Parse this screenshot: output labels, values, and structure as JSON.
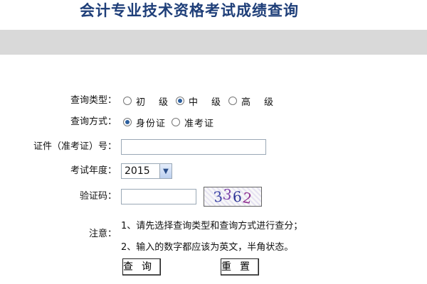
{
  "page": {
    "title": "会计专业技术资格考试成绩查询"
  },
  "form": {
    "query_type": {
      "label": "查询类型：",
      "options": [
        {
          "label": "初　级",
          "checked": false
        },
        {
          "label": "中　级",
          "checked": true
        },
        {
          "label": "高　级",
          "checked": false
        }
      ]
    },
    "query_method": {
      "label": "查询方式：",
      "options": [
        {
          "label": "身份证",
          "checked": true
        },
        {
          "label": "准考证",
          "checked": false
        }
      ]
    },
    "id_number": {
      "label": "证件（准考证）号：",
      "value": "",
      "placeholder": ""
    },
    "exam_year": {
      "label": "考试年度：",
      "selected": "2015"
    },
    "verification_code": {
      "label": "验证码：",
      "value": "",
      "placeholder": "",
      "captcha_digits": [
        "3",
        "3",
        "6",
        "2"
      ]
    },
    "notes": {
      "label": "注意：",
      "items": [
        "1、请先选择查询类型和查询方式进行查分；",
        "2、输入的数字都应该为英文，半角状态。"
      ]
    },
    "buttons": {
      "search": "查询",
      "reset": "重置"
    }
  },
  "colors": {
    "title": "#1f3f79",
    "band": "#d9d9d9",
    "radio_checked": "#2c5f9e"
  },
  "icons": {
    "select_arrow": "chevron-down-icon"
  }
}
